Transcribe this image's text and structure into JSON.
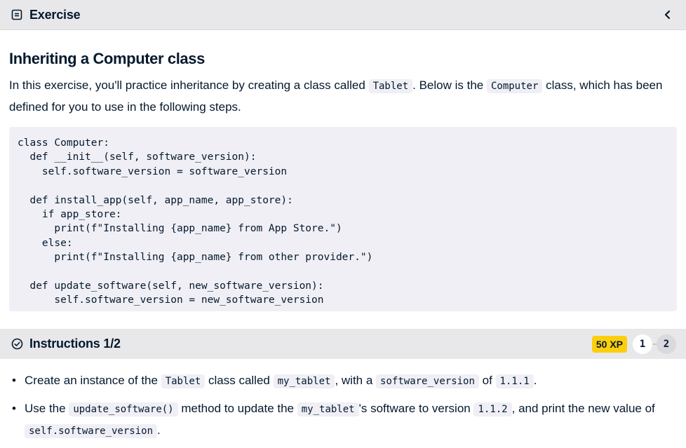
{
  "header": {
    "title": "Exercise",
    "icon": "document-icon",
    "collapse_icon": "chevron-left-icon"
  },
  "exercise": {
    "title": "Inheriting a Computer class",
    "desc_part1": "In this exercise, you'll practice inheritance by creating a class called ",
    "desc_code1": "Tablet",
    "desc_part2": ". Below is the ",
    "desc_code2": "Computer",
    "desc_part3": " class, which has been defined for you to use in the following steps.",
    "code": "class Computer:\n  def __init__(self, software_version):\n    self.software_version = software_version\n\n  def install_app(self, app_name, app_store):\n    if app_store:\n      print(f\"Installing {app_name} from App Store.\")\n    else:\n      print(f\"Installing {app_name} from other provider.\")\n\n  def update_software(self, new_software_version):\n      self.software_version = new_software_version"
  },
  "instructions": {
    "title": "Instructions 1/2",
    "xp": "50 XP",
    "steps": [
      "1",
      "2"
    ],
    "items": [
      {
        "t1": "Create an instance of the ",
        "c1": "Tablet",
        "t2": " class called ",
        "c2": "my_tablet",
        "t3": ", with a ",
        "c3": "software_version",
        "t4": " of ",
        "c4": "1.1.1",
        "t5": "."
      },
      {
        "t1": "Use the ",
        "c1": "update_software()",
        "t2": " method to update the ",
        "c2": "my_tablet",
        "t3": "'s software to version ",
        "c3": "1.1.2",
        "t4": ", and print the new value of ",
        "c4": "self.software_version",
        "t5": "."
      }
    ]
  }
}
